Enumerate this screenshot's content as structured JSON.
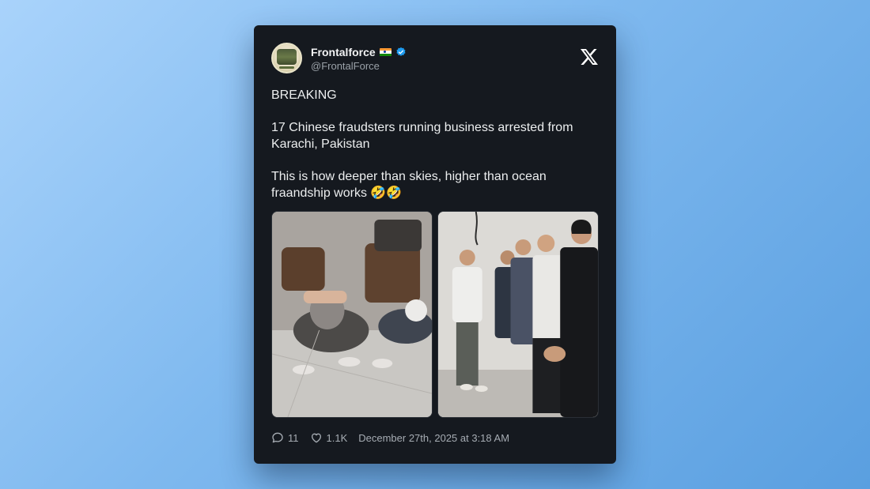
{
  "author": {
    "name": "Frontalforce",
    "handle": "@FrontalForce",
    "flag_icon": "india-flag-icon",
    "verified_icon": "verified-badge-icon"
  },
  "tweet": {
    "paragraphs": [
      "BREAKING",
      "17 Chinese fraudsters running business arrested from Karachi, Pakistan",
      "This is how deeper than skies, higher than ocean fraandship works 🤣🤣"
    ]
  },
  "footer": {
    "replies": "11",
    "likes": "1.1K",
    "timestamp": "December 27th, 2025 at 3:18 AM"
  },
  "colors": {
    "card_bg": "#15191f",
    "verified_blue": "#1d9bf0",
    "muted_text": "#9aa1a8"
  }
}
